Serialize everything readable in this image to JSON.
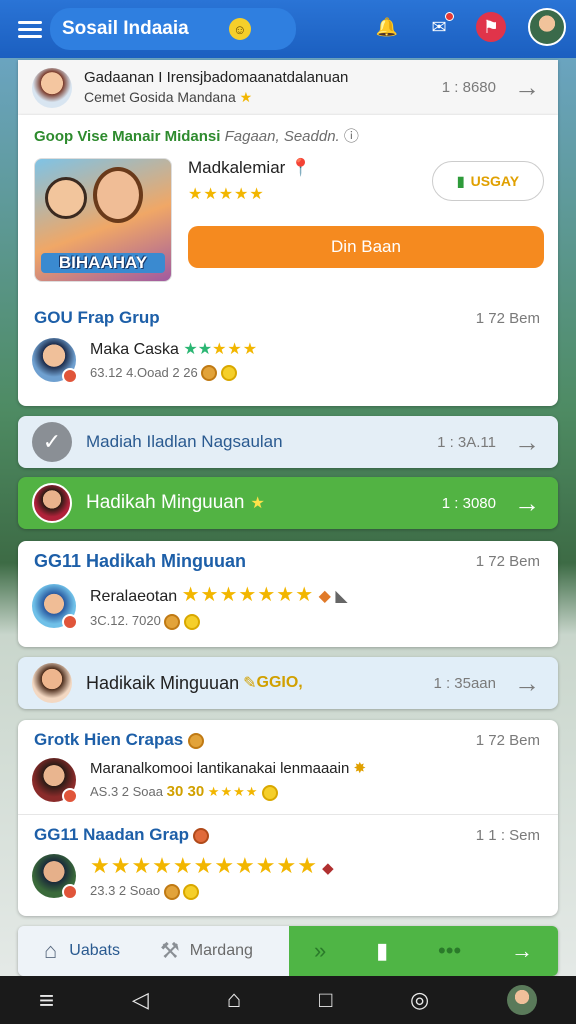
{
  "header": {
    "title": "Sosail Indaaia"
  },
  "card1": {
    "title": "Gadaanan I Irensjbadomaanatdalanuan",
    "subtitle": "Cemet Gosida Mandana",
    "time": "1 : 8680"
  },
  "promo": {
    "header": "Goop Vise Manair Midansi",
    "header_muted": "Fagaan, Seaddn.",
    "image_text": "BIHAAHAY",
    "name": "Madkalemiar",
    "rating_stars": "★★★★★",
    "usgay_label": "USGAY",
    "button_label": "Din Baan",
    "group_title": "GOU Frap Grup",
    "group_time": "1 72 Bem",
    "member_name": "Maka Caska",
    "member_meta": "63.12 4.Ooad 2 26"
  },
  "row_gray": {
    "title": "Madiah Iladlan Nagsaulan",
    "time": "1 : 3A.11"
  },
  "row_green": {
    "title": "Hadikah Minguuan",
    "time": "1 : 3080"
  },
  "card2": {
    "title": "GG11 Hadikah Minguuan",
    "time": "1 72 Bem",
    "member_name": "Reralaeotan",
    "meta": "3C.12. 7020"
  },
  "row_blue": {
    "title": "Hadikaik Minguuan",
    "badge": "GGIO,",
    "time": "1 : 35aan"
  },
  "card3": {
    "group1_title": "Grotk Hien Crapas",
    "group1_time": "1 72 Bem",
    "group1_member": "Maranalkomooi lantikanakai lenmaaain",
    "group1_meta": "AS.3 2 Soaa",
    "group1_points": "30 30",
    "group2_title": "GG11 Naadan Grap",
    "group2_time": "1 1 : Sem",
    "group2_meta": "23.3 2 Soao"
  },
  "tabbar": {
    "tab1": "Uabats",
    "tab2": "Mardang"
  }
}
